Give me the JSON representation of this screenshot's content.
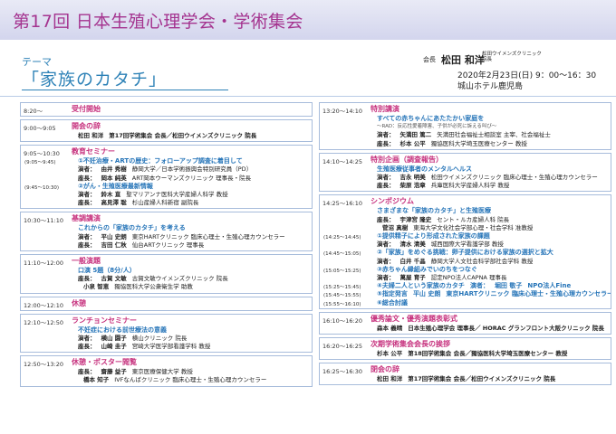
{
  "header": {
    "title": "第17回 日本生殖心理学会・学術集会"
  },
  "theme": {
    "label": "テーマ",
    "title": "「家族のカタチ」"
  },
  "organizer": {
    "role": "会長",
    "name": "松田 和洋",
    "affil": "松田ウイメンズクリニック 院長",
    "date": "2020年2月23日(日) 9：00～16：30",
    "venue": "城山ホテル鹿児島"
  },
  "left": [
    {
      "time": "8:20～",
      "rows": [
        {
          "t": [
            "受付開始"
          ],
          "c": "h"
        }
      ]
    },
    {
      "time": "9:00～9:05",
      "rows": [
        {
          "t": [
            "開会の辞"
          ],
          "c": "h"
        },
        {
          "t": [
            "松田 和洋",
            "第17回学術集会 会長／松田ウイメンズクリニック 院長"
          ],
          "c": "k"
        }
      ]
    },
    {
      "time": "9:05～10:30",
      "rows": [
        {
          "t": [
            "教育セミナー"
          ],
          "c": "h"
        },
        {
          "time": "(9:05～9:45)",
          "t": [
            "①不妊治療・ARTの歴史：フォローアップ調査に着目して"
          ],
          "c": "b"
        },
        {
          "t": [
            "演者：",
            "由井 秀樹",
            "静岡大学／日本学術振興会特別研究員（PD）"
          ],
          "c": "k"
        },
        {
          "t": [
            "座長：",
            "岡本 純英",
            "ART岡本ウーマンズクリニック 理事長・院長"
          ],
          "c": "k"
        },
        {
          "time": "(9:45～10:30)",
          "t": [
            "②がん・生殖医療最新情報"
          ],
          "c": "b"
        },
        {
          "t": [
            "演者：",
            "鈴木 直",
            "聖マリアンナ医科大学産婦人科学 教授"
          ],
          "c": "k"
        },
        {
          "t": [
            "座長：",
            "高見澤 聡",
            "杉山産婦人科新宿 副院長"
          ],
          "c": "k"
        }
      ]
    },
    {
      "time": "10:30～11:10",
      "rows": [
        {
          "t": [
            "基調講演"
          ],
          "c": "h"
        },
        {
          "t": [
            "これからの「家族のカタチ」を考える"
          ],
          "c": "b"
        },
        {
          "t": [
            "演者：",
            "平山 史朗",
            "東京HARTクリニック 臨床心理士・生殖心理カウンセラー"
          ],
          "c": "k"
        },
        {
          "t": [
            "座長：",
            "吉田 仁秋",
            "仙台ARTクリニック 理事長"
          ],
          "c": "k"
        }
      ]
    },
    {
      "time": "11:10～12:00",
      "rows": [
        {
          "t": [
            "一般演題"
          ],
          "c": "h"
        },
        {
          "t": [
            "口演 5題（8分/人）"
          ],
          "c": "b"
        },
        {
          "t": [
            "座長：",
            "古賀 文敏",
            "古賀文敏ウイメンズクリニック 院長"
          ],
          "c": "k"
        },
        {
          "t": [
            "",
            "小泉 智恵",
            "獨協医科大学公衆衛生学 助教"
          ],
          "c": "k"
        }
      ]
    },
    {
      "time": "12:00～12:10",
      "rows": [
        {
          "t": [
            "休憩"
          ],
          "c": "h"
        }
      ]
    },
    {
      "time": "12:10～12:50",
      "rows": [
        {
          "t": [
            "ランチョンセミナー"
          ],
          "c": "h"
        },
        {
          "t": [
            "不妊症における前世療法の意義"
          ],
          "c": "b"
        },
        {
          "t": [
            "演者：",
            "横山 園子",
            "横山クリニック 院長"
          ],
          "c": "k"
        },
        {
          "t": [
            "座長：",
            "山崎 圭子",
            "宮崎大学医学部看護学科 教授"
          ],
          "c": "k"
        }
      ]
    },
    {
      "time": "12:50～13:20",
      "rows": [
        {
          "t": [
            "休憩・ポスター閲覧"
          ],
          "c": "h"
        },
        {
          "t": [
            "座長：",
            "齋藤 益子",
            "東京医療保健大学 教授"
          ],
          "c": "k"
        },
        {
          "t": [
            "",
            "橋本 知子",
            "IVFなんばクリニック 臨床心理士・生殖心理カウンセラー"
          ],
          "c": "k"
        }
      ]
    }
  ],
  "right": [
    {
      "time": "13:20～14:10",
      "rows": [
        {
          "t": [
            "特別講演"
          ],
          "c": "h"
        },
        {
          "t": [
            "すべての赤ちゃんにあたたかい家庭を"
          ],
          "c": "b"
        },
        {
          "t": [
            "～RAD：反応性愛着障害、子供が必死に訴える叫び～"
          ],
          "c": "g"
        },
        {
          "t": [
            "演者：",
            "矢満田 篤二",
            "矢満田社会福祉士相談室 主宰、社会福祉士"
          ],
          "c": "k"
        },
        {
          "t": [
            "座長：",
            "杉本 公平",
            "獨協医科大学埼玉医療センター 教授"
          ],
          "c": "k"
        }
      ]
    },
    {
      "time": "14:10～14:25",
      "rows": [
        {
          "t": [
            "特別企画（調査報告）"
          ],
          "c": "h"
        },
        {
          "t": [
            "生殖医療従事者のメンタルヘルス"
          ],
          "c": "b"
        },
        {
          "t": [
            "演者：",
            "吉永 明美",
            "松田ウイメンズクリニック 臨床心理士・生殖心理カウンセラー"
          ],
          "c": "k"
        },
        {
          "t": [
            "座長：",
            "柴原 浩章",
            "兵庫医科大学産婦人科学 教授"
          ],
          "c": "k"
        }
      ]
    },
    {
      "time": "14:25～16:10",
      "rows": [
        {
          "t": [
            "シンポジウム"
          ],
          "c": "h"
        },
        {
          "t": [
            "さまざまな「家族のカタチ」と生殖医療"
          ],
          "c": "b"
        },
        {
          "t": [
            "座長：",
            "宇津宮 隆史",
            "セント・ルカ産婦人科 院長"
          ],
          "c": "k"
        },
        {
          "t": [
            "",
            "菅沼 真樹",
            "東海大学文化社会学部心理・社会学科 准教授"
          ],
          "c": "k"
        },
        {
          "time": "(14:25～14:45)",
          "t": [
            "①提供精子により形成された家族の課題"
          ],
          "c": "b"
        },
        {
          "t": [
            "演者：",
            "清水 清美",
            "城西国際大学看護学部 教授"
          ],
          "c": "k"
        },
        {
          "time": "(14:45～15:05)",
          "t": [
            "②「家族」をめぐる挑戦：卵子提供における家族の選択と拡大"
          ],
          "c": "b"
        },
        {
          "t": [
            "演者：",
            "白井 千晶",
            "静岡大学人文社会科学部社会学科 教授"
          ],
          "c": "k"
        },
        {
          "time": "(15:05～15:25)",
          "t": [
            "③赤ちゃん縁組みでいのちをつなぐ"
          ],
          "c": "b"
        },
        {
          "t": [
            "演者：",
            "萬屋 育子",
            "認定NPO法人CAPNA 理事長"
          ],
          "c": "k"
        },
        {
          "time": "(15:25～15:45)",
          "t": [
            "④夫婦二人という家族のカタチ",
            "演者：",
            "堀田 敬子",
            "NPO法人Fine"
          ],
          "c": "b"
        },
        {
          "time": "(15:45～15:55)",
          "t": [
            "⑤指定発言",
            "平山 史朗",
            "東京HARTクリニック 臨床心理士・生殖心理カウンセラー"
          ],
          "c": "b"
        },
        {
          "time": "(15:55～16:10)",
          "t": [
            "⑥総合討議"
          ],
          "c": "b"
        }
      ]
    },
    {
      "time": "16:10～16:20",
      "rows": [
        {
          "t": [
            "優秀論文・優秀演題表彰式"
          ],
          "c": "h"
        },
        {
          "t": [
            "森本 義晴",
            "日本生殖心理学会 理事長／ HORAC グランフロント大阪クリニック 院長"
          ],
          "c": "k"
        }
      ]
    },
    {
      "time": "16:20～16:25",
      "rows": [
        {
          "t": [
            "次期学術集会会長の挨拶"
          ],
          "c": "h"
        },
        {
          "t": [
            "杉本 公平",
            "第18回学術集会 会長／獨協医科大学埼玉医療センター 教授"
          ],
          "c": "k"
        }
      ]
    },
    {
      "time": "16:25～16:30",
      "rows": [
        {
          "t": [
            "閉会の辞"
          ],
          "c": "h"
        },
        {
          "t": [
            "松田 和洋",
            "第17回学術集会 会長／松田ウイメンズクリニック 院長"
          ],
          "c": "k"
        }
      ]
    }
  ]
}
